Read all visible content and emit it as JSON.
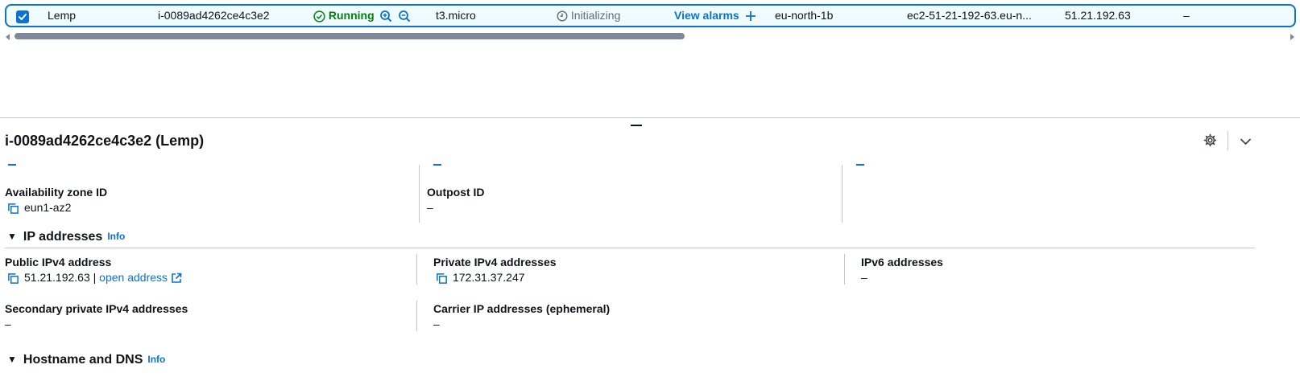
{
  "row": {
    "name": "Lemp",
    "instance_id": "i-0089ad4262ce4c3e2",
    "state": "Running",
    "instance_type": "t3.micro",
    "status_check": "Initializing",
    "alarms_link": "View alarms",
    "availability_zone": "eu-north-1b",
    "public_dns": "ec2-51-21-192-63.eu-n...",
    "public_ip": "51.21.192.63",
    "elastic_ip": "–"
  },
  "panel": {
    "title": "i-0089ad4262ce4c3e2 (Lemp)",
    "availability_zone_id": {
      "label": "Availability zone ID",
      "value": "eun1-az2"
    },
    "outpost_id": {
      "label": "Outpost ID",
      "value": "–"
    },
    "ip_section": {
      "title": "IP addresses",
      "info": "Info"
    },
    "public_ipv4": {
      "label": "Public IPv4 address",
      "value": "51.21.192.63",
      "separator": "|",
      "link": "open address"
    },
    "private_ipv4": {
      "label": "Private IPv4 addresses",
      "value": "172.31.37.247"
    },
    "ipv6": {
      "label": "IPv6 addresses",
      "value": "–"
    },
    "secondary_private_ipv4": {
      "label": "Secondary private IPv4 addresses",
      "value": "–"
    },
    "carrier_ip": {
      "label": "Carrier IP addresses (ephemeral)",
      "value": "–"
    },
    "dns_section": {
      "title": "Hostname and DNS",
      "info": "Info"
    }
  },
  "icons": {
    "checkbox": "checkbox-checked-icon",
    "running": "check-circle-icon",
    "zoom_in": "zoom-in-icon",
    "zoom_out": "zoom-out-icon",
    "initializing": "clock-icon",
    "add": "plus-icon",
    "settings": "gear-icon",
    "collapse": "chevron-down-icon",
    "copy": "copy-icon",
    "external": "external-link-icon"
  },
  "colors": {
    "accent": "#0972d3",
    "success": "#037f0c",
    "muted": "#5f6b7a",
    "selected_bg": "#f0fbff"
  }
}
